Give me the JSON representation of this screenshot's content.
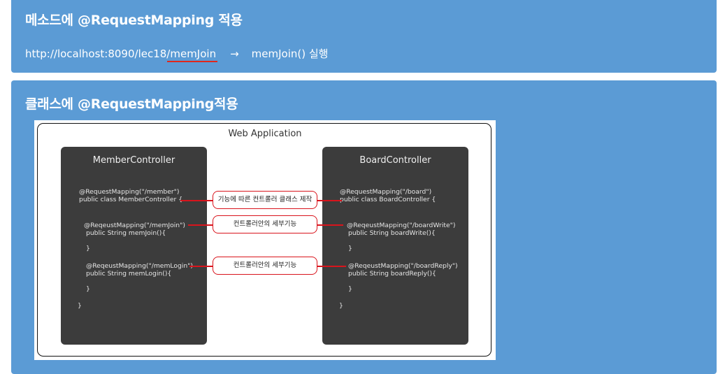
{
  "section1": {
    "title": "메소드에 @RequestMapping 적용",
    "url_prefix": "http://localhost:8090/lec18/",
    "url_highlight": "memJoin",
    "arrow": "→",
    "result": "memJoin() 실행"
  },
  "section2": {
    "title": "클래스에 @RequestMapping적용",
    "diagram": {
      "title": "Web Application",
      "left": {
        "name": "MemberController",
        "class_mapping": "@RequestMapping(\"/member\")",
        "class_decl": "public class MemberController {",
        "m1_mapping": "@ReqeustMapping(\"/memJoin\")",
        "m1_decl": "public String memJoin(){",
        "m1_close": "}",
        "m2_mapping": "@ReqeustMapping(\"/memLogin\")",
        "m2_decl": "public String memLogin(){",
        "m2_close": "}",
        "class_close": "}"
      },
      "right": {
        "name": "BoardController",
        "class_mapping": "@RequestMapping(\"/board\")",
        "class_decl": "public class BoardController {",
        "m1_mapping": "@ReqeustMapping(\"/boardWrite\")",
        "m1_decl": "public String boardWrite(){",
        "m1_close": "}",
        "m2_mapping": "@ReqeustMapping(\"/boardReply\")",
        "m2_decl": "public String boardReply(){",
        "m2_close": "}",
        "class_close": "}"
      },
      "labels": {
        "class_level": "기능에 따른 컨트롤러 클래스 제작",
        "method_level_1": "컨트롤러안의 세부기능",
        "method_level_2": "컨트롤러안의 세부기능"
      }
    }
  }
}
